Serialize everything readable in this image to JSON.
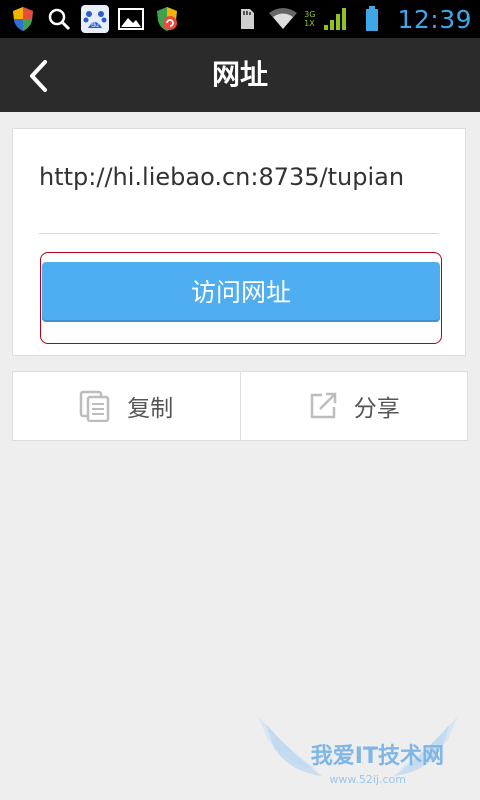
{
  "status_bar": {
    "time": "12:39",
    "network_3g": "3G",
    "network_1x": "1X",
    "icons": [
      "shield-icon",
      "search-icon",
      "baidu-icon",
      "image-icon",
      "security-icon",
      "sd-card-icon",
      "wifi-icon",
      "signal-icon",
      "battery-icon"
    ]
  },
  "header": {
    "title": "网址",
    "back_icon": "chevron-left-icon"
  },
  "url_card": {
    "url": "http://hi.liebao.cn:8735/tupian",
    "visit_label": "访问网址"
  },
  "actions": [
    {
      "label": "复制",
      "icon": "copy-icon"
    },
    {
      "label": "分享",
      "icon": "share-icon"
    }
  ],
  "watermark": {
    "text": "我爱IT技术网",
    "url": "www.52ij.com"
  },
  "colors": {
    "status_bg": "#000000",
    "title_bg": "#2b2b2b",
    "page_bg": "#eeeeee",
    "accent_blue": "#4fadf2",
    "highlight_red": "#b5001a",
    "time_blue": "#3da7e8"
  }
}
